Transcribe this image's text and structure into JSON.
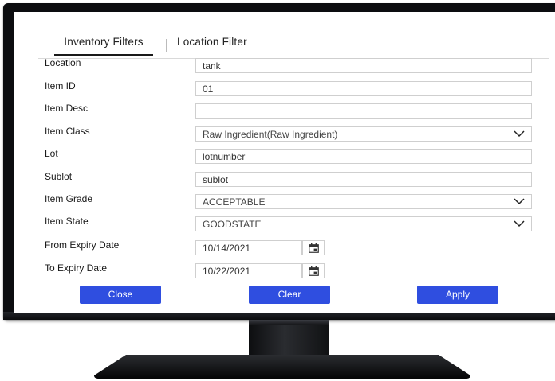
{
  "tabs": [
    "Inventory Filters",
    "Location Filter"
  ],
  "fields": [
    {
      "label": "Location",
      "value": "tank",
      "type": "text"
    },
    {
      "label": "Item ID",
      "value": "01",
      "type": "text"
    },
    {
      "label": "Item Desc",
      "value": "",
      "type": "text"
    },
    {
      "label": "Item Class",
      "value": "Raw Ingredient(Raw Ingredient)",
      "type": "select"
    },
    {
      "label": "Lot",
      "value": "lotnumber",
      "type": "text"
    },
    {
      "label": "Sublot",
      "value": "sublot",
      "type": "text"
    },
    {
      "label": "Item Grade",
      "value": "ACCEPTABLE",
      "type": "select"
    },
    {
      "label": "Item State",
      "value": "GOODSTATE",
      "type": "select"
    },
    {
      "label": "From Expiry Date",
      "value": "10/14/2021",
      "type": "date"
    },
    {
      "label": "To Expiry Date",
      "value": "10/22/2021",
      "type": "date"
    }
  ],
  "buttons": {
    "close": "Close",
    "clear": "Clear",
    "apply": "Apply"
  },
  "colors": {
    "button": "#2f4ee0",
    "bezel": "#0c0d10"
  }
}
